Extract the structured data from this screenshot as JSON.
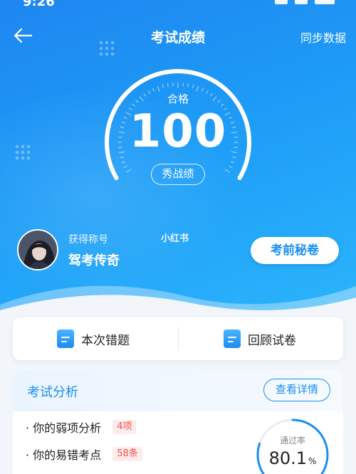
{
  "status_bar": {
    "time": "9:26"
  },
  "header": {
    "title": "考试成绩",
    "sync_label": "同步数据"
  },
  "result": {
    "label": "合格",
    "score": "100",
    "show_label": "秀战绩",
    "score_progress": 1.0
  },
  "profile": {
    "caption": "获得称号",
    "title": "驾考传奇",
    "watermark": "小红书",
    "secret_button": "考前秘卷"
  },
  "actions": {
    "wrong_label": "本次错题",
    "review_label": "回顾试卷"
  },
  "analysis": {
    "title": "考试分析",
    "detail_button": "查看详情",
    "rows": [
      {
        "label": "· 你的弱项分析",
        "tag": "4项"
      },
      {
        "label": "· 你的易错考点",
        "tag": "58条"
      }
    ],
    "pass_rate_label": "通过率",
    "pass_rate_value": "80.1",
    "pass_rate_unit": "%",
    "pass_rate_fraction": 0.801
  },
  "colors": {
    "accent": "#1a8ff0",
    "tag_red": "#f0504f"
  }
}
